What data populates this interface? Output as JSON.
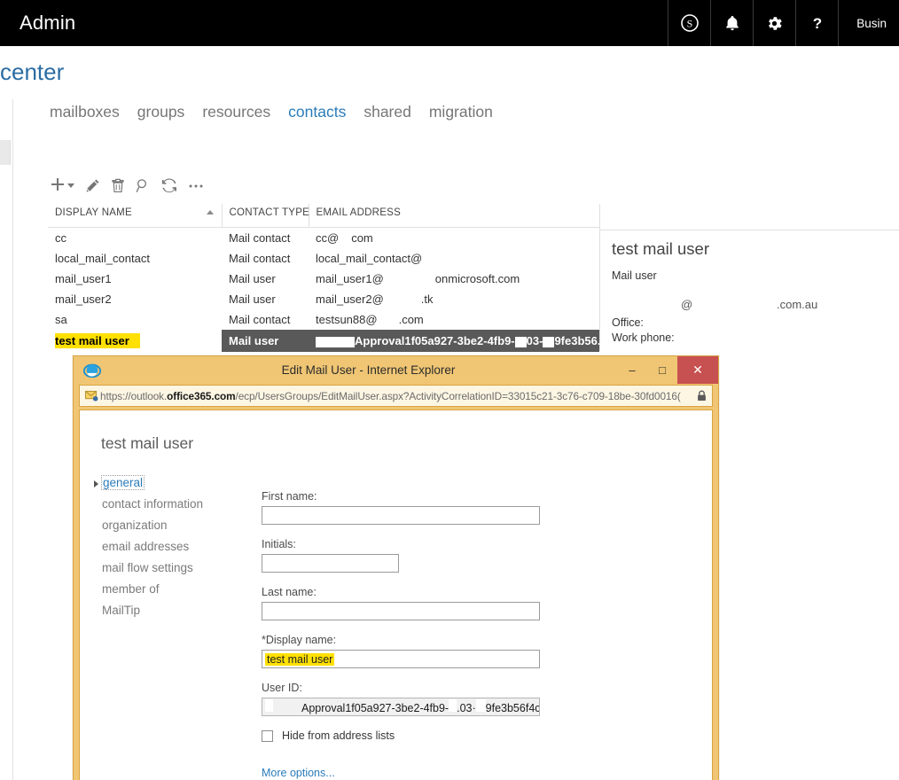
{
  "suite": {
    "title": "Admin",
    "icons": [
      {
        "name": "skype-icon",
        "label": "Skype"
      },
      {
        "name": "bell-icon",
        "label": "Notifications"
      },
      {
        "name": "gear-icon",
        "label": "Settings"
      },
      {
        "name": "help-icon",
        "label": "Help"
      }
    ],
    "user": "Busin"
  },
  "page": {
    "title": "center"
  },
  "tabs": [
    {
      "label": "mailboxes",
      "active": false
    },
    {
      "label": "groups",
      "active": false
    },
    {
      "label": "resources",
      "active": false
    },
    {
      "label": "contacts",
      "active": true
    },
    {
      "label": "shared",
      "active": false
    },
    {
      "label": "migration",
      "active": false
    }
  ],
  "toolbar": [
    {
      "name": "add-button",
      "icon": "plus-icon",
      "label": "New"
    },
    {
      "name": "edit-button",
      "icon": "pencil-icon",
      "label": "Edit"
    },
    {
      "name": "delete-button",
      "icon": "trash-icon",
      "label": "Delete"
    },
    {
      "name": "search-button",
      "icon": "search-icon",
      "label": "Search"
    },
    {
      "name": "refresh-button",
      "icon": "refresh-icon",
      "label": "Refresh"
    },
    {
      "name": "more-button",
      "icon": "ellipsis-icon",
      "label": "More options"
    }
  ],
  "table": {
    "columns": [
      "DISPLAY NAME",
      "CONTACT TYPE",
      "EMAIL ADDRESS"
    ],
    "sorted_column": "DISPLAY NAME",
    "sort_direction": "ascending",
    "rows": [
      {
        "display_name": "cc",
        "contact_type": "Mail contact",
        "email_prefix": "cc@",
        "email_suffix": "com",
        "selected": false
      },
      {
        "display_name": "local_mail_contact",
        "contact_type": "Mail contact",
        "email_prefix": "local_mail_contact@",
        "email_suffix": "",
        "selected": false
      },
      {
        "display_name": "mail_user1",
        "contact_type": "Mail user",
        "email_prefix": "mail_user1@",
        "email_suffix": "onmicrosoft.com",
        "selected": false
      },
      {
        "display_name": "mail_user2",
        "contact_type": "Mail user",
        "email_prefix": "mail_user2@",
        "email_suffix": ".tk",
        "selected": false
      },
      {
        "display_name": "sa",
        "contact_type": "Mail contact",
        "email_prefix": "testsun88@",
        "email_suffix": ".com",
        "selected": false
      },
      {
        "display_name": "test mail user",
        "contact_type": "Mail user",
        "email_prefix": "Approval1f05a927-3be2-4fb9-",
        "email_suffix": "03-",
        "email_tail": "9fe3b56...",
        "selected": true
      }
    ]
  },
  "detail": {
    "name": "test mail user",
    "type": "Mail user",
    "email_at": "@",
    "email_domain": ".com.au",
    "office_label": "Office:",
    "work_phone_label": "Work phone:"
  },
  "dialog": {
    "window_title": "Edit Mail User - Internet Explorer",
    "favicon": "internet-explorer-icon",
    "url_scheme": "https://outlook.",
    "url_host": "office365.com",
    "url_path": "/ecp/UsersGroups/EditMailUser.aspx?ActivityCorrelationID=33015c21-3c76-c709-18be-30fd0016(",
    "controls": {
      "minimize": "–",
      "maximize": "□",
      "close": "✕"
    },
    "form_title": "test mail user",
    "nav": [
      {
        "label": "general",
        "active": true
      },
      {
        "label": "contact information",
        "active": false
      },
      {
        "label": "organization",
        "active": false
      },
      {
        "label": "email addresses",
        "active": false
      },
      {
        "label": "mail flow settings",
        "active": false
      },
      {
        "label": "member of",
        "active": false
      },
      {
        "label": "MailTip",
        "active": false
      }
    ],
    "fields": {
      "first_name_label": "First name:",
      "first_name_value": "",
      "initials_label": "Initials:",
      "initials_value": "",
      "last_name_label": "Last name:",
      "last_name_value": "",
      "display_name_label": "*Display name:",
      "display_name_value": "test mail user",
      "user_id_label": "User ID:",
      "user_id_part1": "Approval1f05a927-3be2-4fb9-",
      "user_id_part2": ".03·",
      "user_id_part3": "9fe3b56f4c¢"
    },
    "hide_from_address_lists_label": "Hide from address lists",
    "hide_from_address_lists_checked": false,
    "more_options_label": "More options..."
  },
  "colors": {
    "accent_blue": "#2b7cb9",
    "highlight_yellow": "#ffe000",
    "selected_row": "#595959",
    "dialog_chrome": "#f0c674",
    "close_red": "#c75050",
    "suite_bar": "#000000"
  }
}
